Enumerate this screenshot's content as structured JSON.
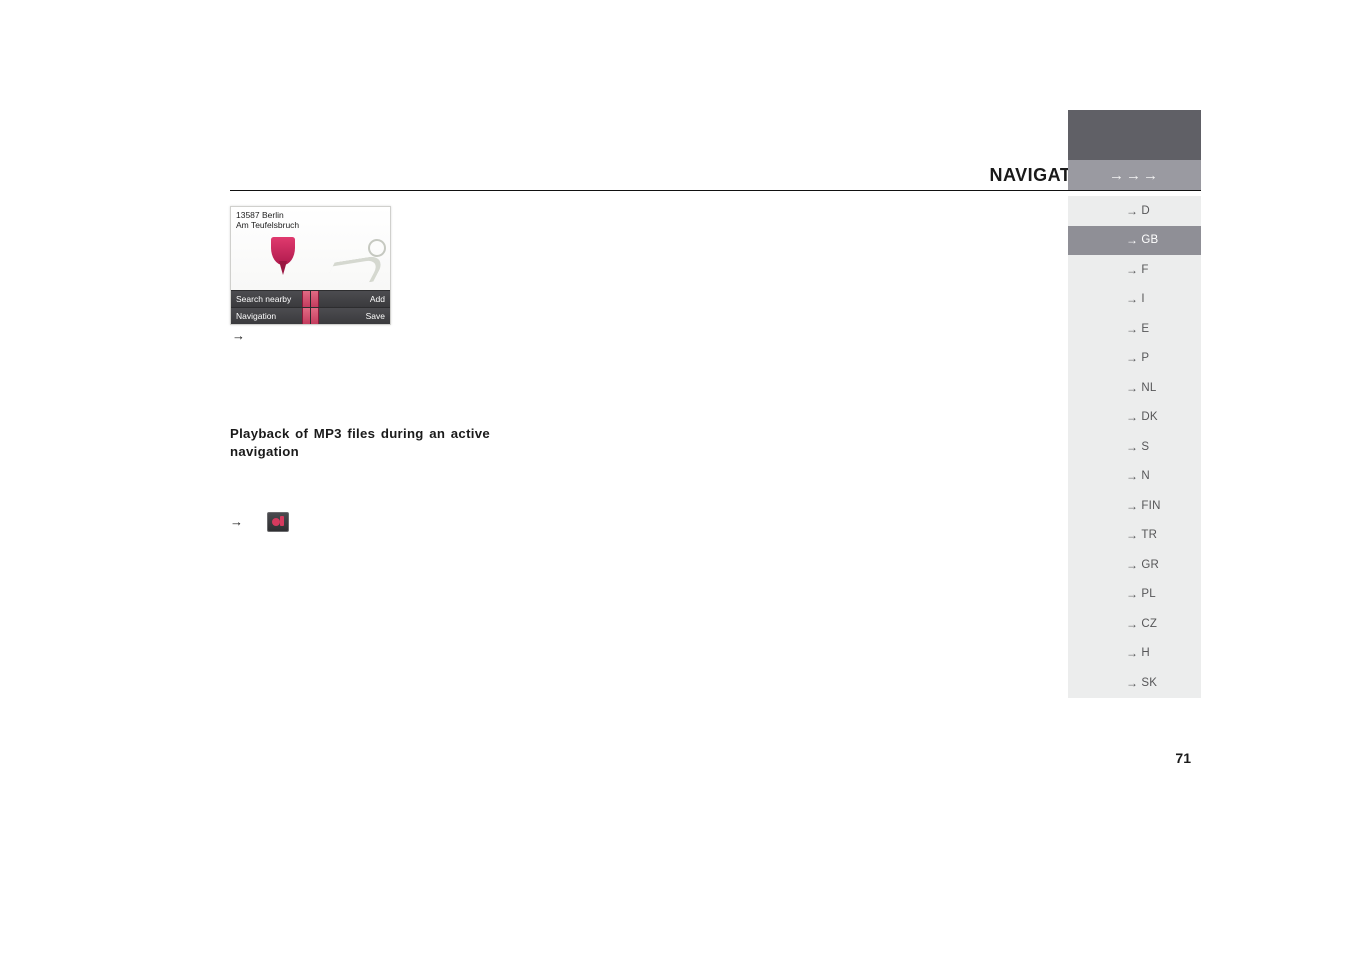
{
  "header": {
    "title": "NAVIGATIONAL MODE",
    "arrows": "→→→"
  },
  "screenshot": {
    "line1": "13587 Berlin",
    "line2": "Am Teufelsbruch",
    "btn_search": "Search nearby",
    "btn_add": "Add",
    "btn_nav": "Navigation",
    "btn_save": "Save"
  },
  "under_arrow": "→",
  "section_title": "Playback of MP3 files during an active navigation",
  "bullet_arrow": "→",
  "sidebar": {
    "items": [
      {
        "code": "D",
        "active": false
      },
      {
        "code": "GB",
        "active": true
      },
      {
        "code": "F",
        "active": false
      },
      {
        "code": "I",
        "active": false
      },
      {
        "code": "E",
        "active": false
      },
      {
        "code": "P",
        "active": false
      },
      {
        "code": "NL",
        "active": false
      },
      {
        "code": "DK",
        "active": false
      },
      {
        "code": "S",
        "active": false
      },
      {
        "code": "N",
        "active": false
      },
      {
        "code": "FIN",
        "active": false
      },
      {
        "code": "TR",
        "active": false
      },
      {
        "code": "GR",
        "active": false
      },
      {
        "code": "PL",
        "active": false
      },
      {
        "code": "CZ",
        "active": false
      },
      {
        "code": "H",
        "active": false
      },
      {
        "code": "SK",
        "active": false
      }
    ]
  },
  "page_number": "71"
}
